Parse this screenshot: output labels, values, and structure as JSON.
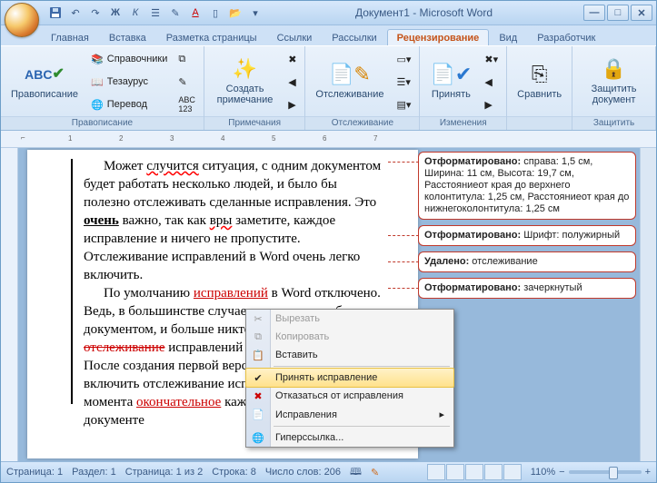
{
  "title": "Документ1 - Microsoft Word",
  "colors": {
    "accent": "#c5541a"
  },
  "qat": {
    "save": "save-icon",
    "undo": "undo-icon",
    "redo": "redo-icon",
    "bold": "Ж",
    "italic": "К",
    "ul": "underline",
    "bullets": "list",
    "color": "A",
    "new": "new",
    "open": "open"
  },
  "tabs": [
    "Главная",
    "Вставка",
    "Разметка страницы",
    "Ссылки",
    "Рассылки",
    "Рецензирование",
    "Вид",
    "Разработчик"
  ],
  "active_tab": 5,
  "ribbon_groups": {
    "proofing": {
      "label": "Правописание",
      "spellcheck": "Правописание",
      "research": "Справочники",
      "thesaurus": "Тезаурус",
      "translate": "Перевод"
    },
    "comments": {
      "label": "Примечания",
      "new": "Создать примечание"
    },
    "tracking": {
      "label": "Отслеживание",
      "track": "Отслеживание"
    },
    "changes": {
      "label": "Изменения",
      "accept": "Принять"
    },
    "compare": {
      "label": "",
      "button": "Сравнить"
    },
    "protect": {
      "label": "Защитить",
      "button": "Защитить документ"
    }
  },
  "document": {
    "p1_a": "Может ",
    "p1_b": "случится",
    "p1_c": " ситуация, с одним документом будет работать несколько людей, и было бы полезно отслеживать сделанные исправления. Это ",
    "p1_d": "очень",
    "p1_e": " важно, так как ",
    "p1_f": "вры",
    "p1_g": " заметите, каждое исправление и ничего не пропустите. Отслеживание исправлений в Word очень легко включить.",
    "p2_a": "По умолчанию ",
    "p2_b": "исправлений",
    "p2_c": " в Word отключено. Ведь, в большинстве случаев, только мы работаем с документом, и больше никто. На практике, ",
    "p2_d": "отслеживание",
    "p2_e": " исправлений в Word работает так: После создания первой версии документа надо включить отслеживание исправлений. С этого момента ",
    "p2_f": "окончательное",
    "p2_g": " каждое изменение в документе"
  },
  "balloons": [
    {
      "title": "Отформатировано:",
      "body": " справа:  1,5 см, Ширина:  11 см, Высота:  19,7 см, Расстояниеот края до верхнего колонтитула: 1,25 см, Расстояниеот края до нижнегоколонтитула: 1,25 см"
    },
    {
      "title": "Отформатировано:",
      "body": " Шрифт: полужирный"
    },
    {
      "title": "Удалено:",
      "body": " отслеживание"
    },
    {
      "title": "Отформатировано:",
      "body": " зачеркнутый"
    }
  ],
  "contextmenu": {
    "cut": "Вырезать",
    "copy": "Копировать",
    "paste": "Вставить",
    "accept": "Принять исправление",
    "reject": "Отказаться от исправления",
    "changes": "Исправления",
    "hyperlink": "Гиперссылка..."
  },
  "status": {
    "page": "Страница: 1",
    "section": "Раздел: 1",
    "pages": "Страница: 1 из 2",
    "line": "Строка: 8",
    "words": "Число слов: 206",
    "zoom": "110%"
  }
}
